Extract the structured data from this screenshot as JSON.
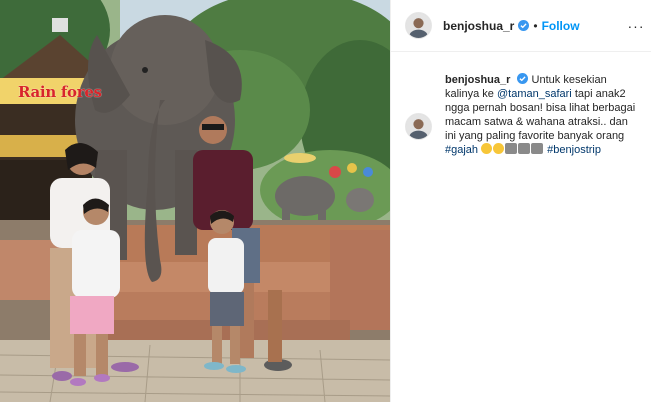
{
  "photo": {
    "sign_text": "Rain fores"
  },
  "header": {
    "username": "benjoshua_r",
    "separator": "•",
    "follow_label": "Follow",
    "more_label": "···"
  },
  "caption": {
    "username": "benjoshua_r",
    "text_1": "Untuk kesekian kalinya ke",
    "mention": "@taman_safari",
    "text_2": "tapi anak2 ngga pernah bosan! bisa lihat berbagai macam satwa & wahana atraksi.. dan ini yang paling favorite banyak orang",
    "hashtag_1": "#gajah",
    "hashtag_2": "#benjostrip"
  },
  "colors": {
    "link": "#0095f6",
    "hashtag": "#00376b",
    "text": "#262626"
  },
  "icons": [
    "verified-badge-icon",
    "more-options-icon",
    "smile-emoji-icon",
    "elephant-emoji-icon"
  ]
}
